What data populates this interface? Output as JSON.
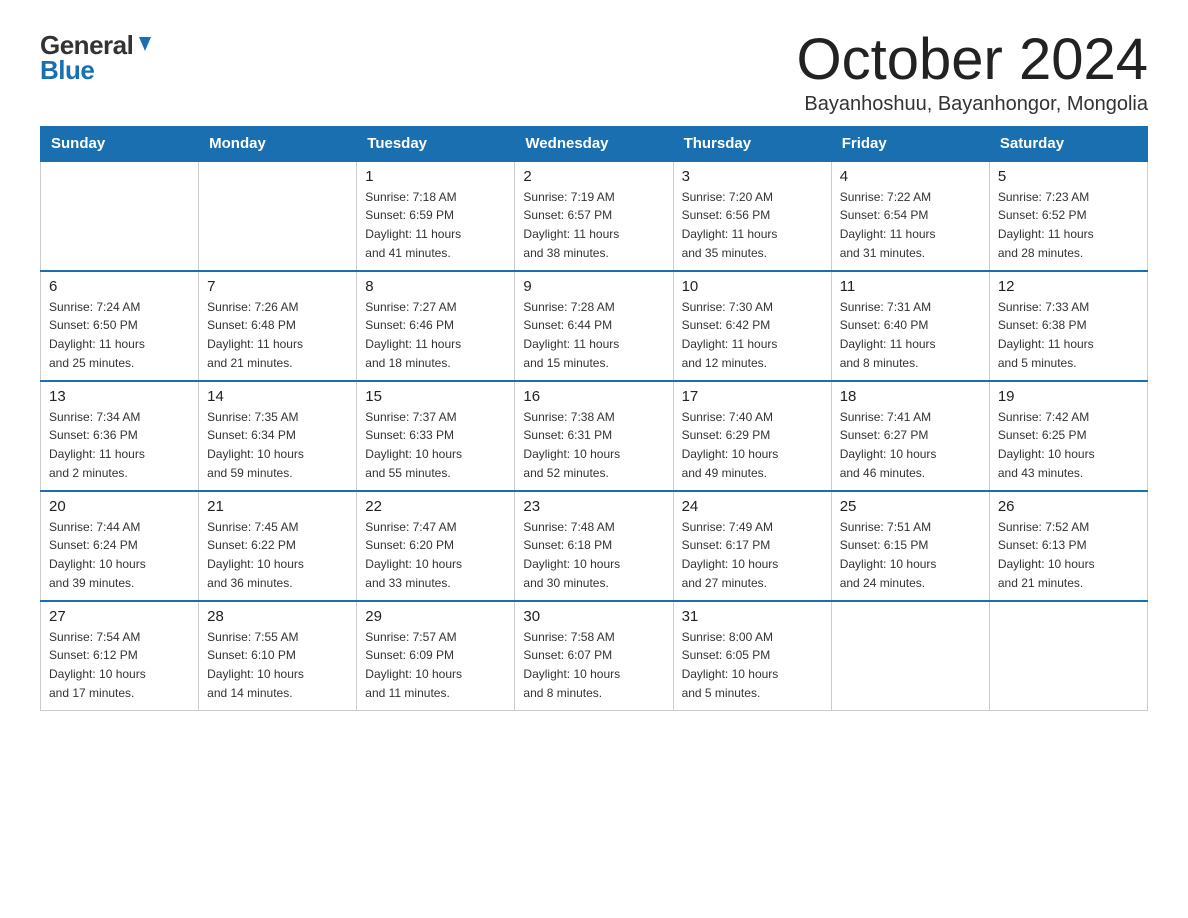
{
  "header": {
    "logo_general": "General",
    "logo_blue": "Blue",
    "title": "October 2024",
    "subtitle": "Bayanhoshuu, Bayanhongor, Mongolia"
  },
  "days_of_week": [
    "Sunday",
    "Monday",
    "Tuesday",
    "Wednesday",
    "Thursday",
    "Friday",
    "Saturday"
  ],
  "weeks": [
    [
      {
        "day": "",
        "info": ""
      },
      {
        "day": "",
        "info": ""
      },
      {
        "day": "1",
        "info": "Sunrise: 7:18 AM\nSunset: 6:59 PM\nDaylight: 11 hours\nand 41 minutes."
      },
      {
        "day": "2",
        "info": "Sunrise: 7:19 AM\nSunset: 6:57 PM\nDaylight: 11 hours\nand 38 minutes."
      },
      {
        "day": "3",
        "info": "Sunrise: 7:20 AM\nSunset: 6:56 PM\nDaylight: 11 hours\nand 35 minutes."
      },
      {
        "day": "4",
        "info": "Sunrise: 7:22 AM\nSunset: 6:54 PM\nDaylight: 11 hours\nand 31 minutes."
      },
      {
        "day": "5",
        "info": "Sunrise: 7:23 AM\nSunset: 6:52 PM\nDaylight: 11 hours\nand 28 minutes."
      }
    ],
    [
      {
        "day": "6",
        "info": "Sunrise: 7:24 AM\nSunset: 6:50 PM\nDaylight: 11 hours\nand 25 minutes."
      },
      {
        "day": "7",
        "info": "Sunrise: 7:26 AM\nSunset: 6:48 PM\nDaylight: 11 hours\nand 21 minutes."
      },
      {
        "day": "8",
        "info": "Sunrise: 7:27 AM\nSunset: 6:46 PM\nDaylight: 11 hours\nand 18 minutes."
      },
      {
        "day": "9",
        "info": "Sunrise: 7:28 AM\nSunset: 6:44 PM\nDaylight: 11 hours\nand 15 minutes."
      },
      {
        "day": "10",
        "info": "Sunrise: 7:30 AM\nSunset: 6:42 PM\nDaylight: 11 hours\nand 12 minutes."
      },
      {
        "day": "11",
        "info": "Sunrise: 7:31 AM\nSunset: 6:40 PM\nDaylight: 11 hours\nand 8 minutes."
      },
      {
        "day": "12",
        "info": "Sunrise: 7:33 AM\nSunset: 6:38 PM\nDaylight: 11 hours\nand 5 minutes."
      }
    ],
    [
      {
        "day": "13",
        "info": "Sunrise: 7:34 AM\nSunset: 6:36 PM\nDaylight: 11 hours\nand 2 minutes."
      },
      {
        "day": "14",
        "info": "Sunrise: 7:35 AM\nSunset: 6:34 PM\nDaylight: 10 hours\nand 59 minutes."
      },
      {
        "day": "15",
        "info": "Sunrise: 7:37 AM\nSunset: 6:33 PM\nDaylight: 10 hours\nand 55 minutes."
      },
      {
        "day": "16",
        "info": "Sunrise: 7:38 AM\nSunset: 6:31 PM\nDaylight: 10 hours\nand 52 minutes."
      },
      {
        "day": "17",
        "info": "Sunrise: 7:40 AM\nSunset: 6:29 PM\nDaylight: 10 hours\nand 49 minutes."
      },
      {
        "day": "18",
        "info": "Sunrise: 7:41 AM\nSunset: 6:27 PM\nDaylight: 10 hours\nand 46 minutes."
      },
      {
        "day": "19",
        "info": "Sunrise: 7:42 AM\nSunset: 6:25 PM\nDaylight: 10 hours\nand 43 minutes."
      }
    ],
    [
      {
        "day": "20",
        "info": "Sunrise: 7:44 AM\nSunset: 6:24 PM\nDaylight: 10 hours\nand 39 minutes."
      },
      {
        "day": "21",
        "info": "Sunrise: 7:45 AM\nSunset: 6:22 PM\nDaylight: 10 hours\nand 36 minutes."
      },
      {
        "day": "22",
        "info": "Sunrise: 7:47 AM\nSunset: 6:20 PM\nDaylight: 10 hours\nand 33 minutes."
      },
      {
        "day": "23",
        "info": "Sunrise: 7:48 AM\nSunset: 6:18 PM\nDaylight: 10 hours\nand 30 minutes."
      },
      {
        "day": "24",
        "info": "Sunrise: 7:49 AM\nSunset: 6:17 PM\nDaylight: 10 hours\nand 27 minutes."
      },
      {
        "day": "25",
        "info": "Sunrise: 7:51 AM\nSunset: 6:15 PM\nDaylight: 10 hours\nand 24 minutes."
      },
      {
        "day": "26",
        "info": "Sunrise: 7:52 AM\nSunset: 6:13 PM\nDaylight: 10 hours\nand 21 minutes."
      }
    ],
    [
      {
        "day": "27",
        "info": "Sunrise: 7:54 AM\nSunset: 6:12 PM\nDaylight: 10 hours\nand 17 minutes."
      },
      {
        "day": "28",
        "info": "Sunrise: 7:55 AM\nSunset: 6:10 PM\nDaylight: 10 hours\nand 14 minutes."
      },
      {
        "day": "29",
        "info": "Sunrise: 7:57 AM\nSunset: 6:09 PM\nDaylight: 10 hours\nand 11 minutes."
      },
      {
        "day": "30",
        "info": "Sunrise: 7:58 AM\nSunset: 6:07 PM\nDaylight: 10 hours\nand 8 minutes."
      },
      {
        "day": "31",
        "info": "Sunrise: 8:00 AM\nSunset: 6:05 PM\nDaylight: 10 hours\nand 5 minutes."
      },
      {
        "day": "",
        "info": ""
      },
      {
        "day": "",
        "info": ""
      }
    ]
  ],
  "colors": {
    "header_bg": "#1a6fb0",
    "header_text": "#ffffff",
    "border": "#1a6fb0",
    "cell_border": "#cccccc"
  }
}
